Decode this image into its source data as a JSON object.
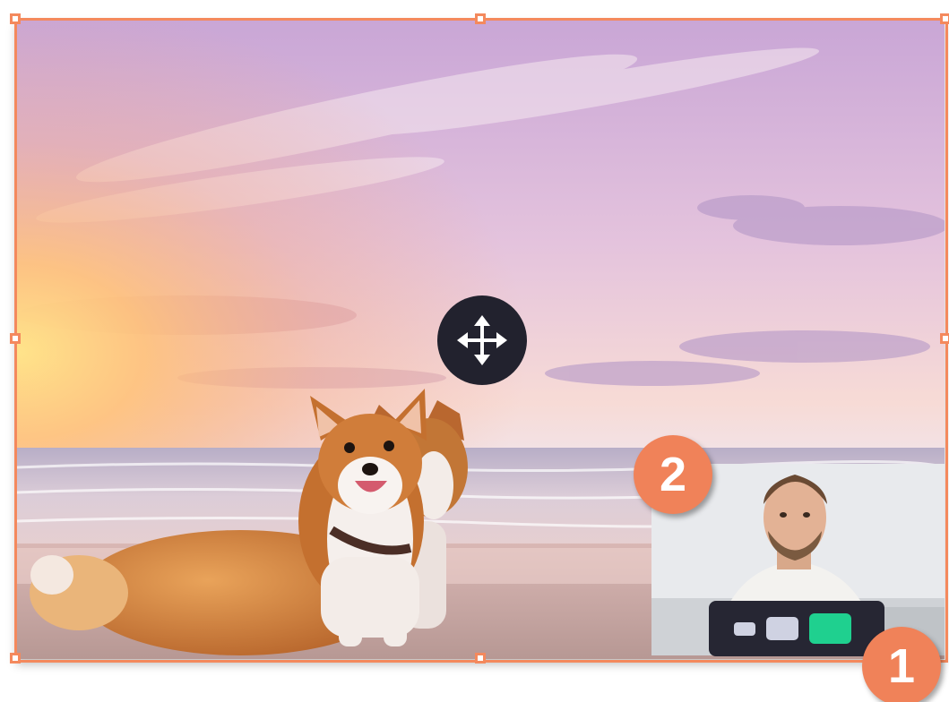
{
  "canvas": {
    "selection_color": "#f4895d",
    "background_image": "beach-sunset-corgis-photo"
  },
  "move_cursor": {
    "icon": "move-arrows-icon",
    "color": "#22222e"
  },
  "webcam_overlay": {
    "image": "man-webcam-photo"
  },
  "layout_switcher": {
    "options": [
      "small",
      "medium",
      "large"
    ],
    "selected": "large",
    "selected_color": "#1fd08f"
  },
  "callouts": {
    "one": "1",
    "two": "2",
    "color": "#f08259"
  }
}
